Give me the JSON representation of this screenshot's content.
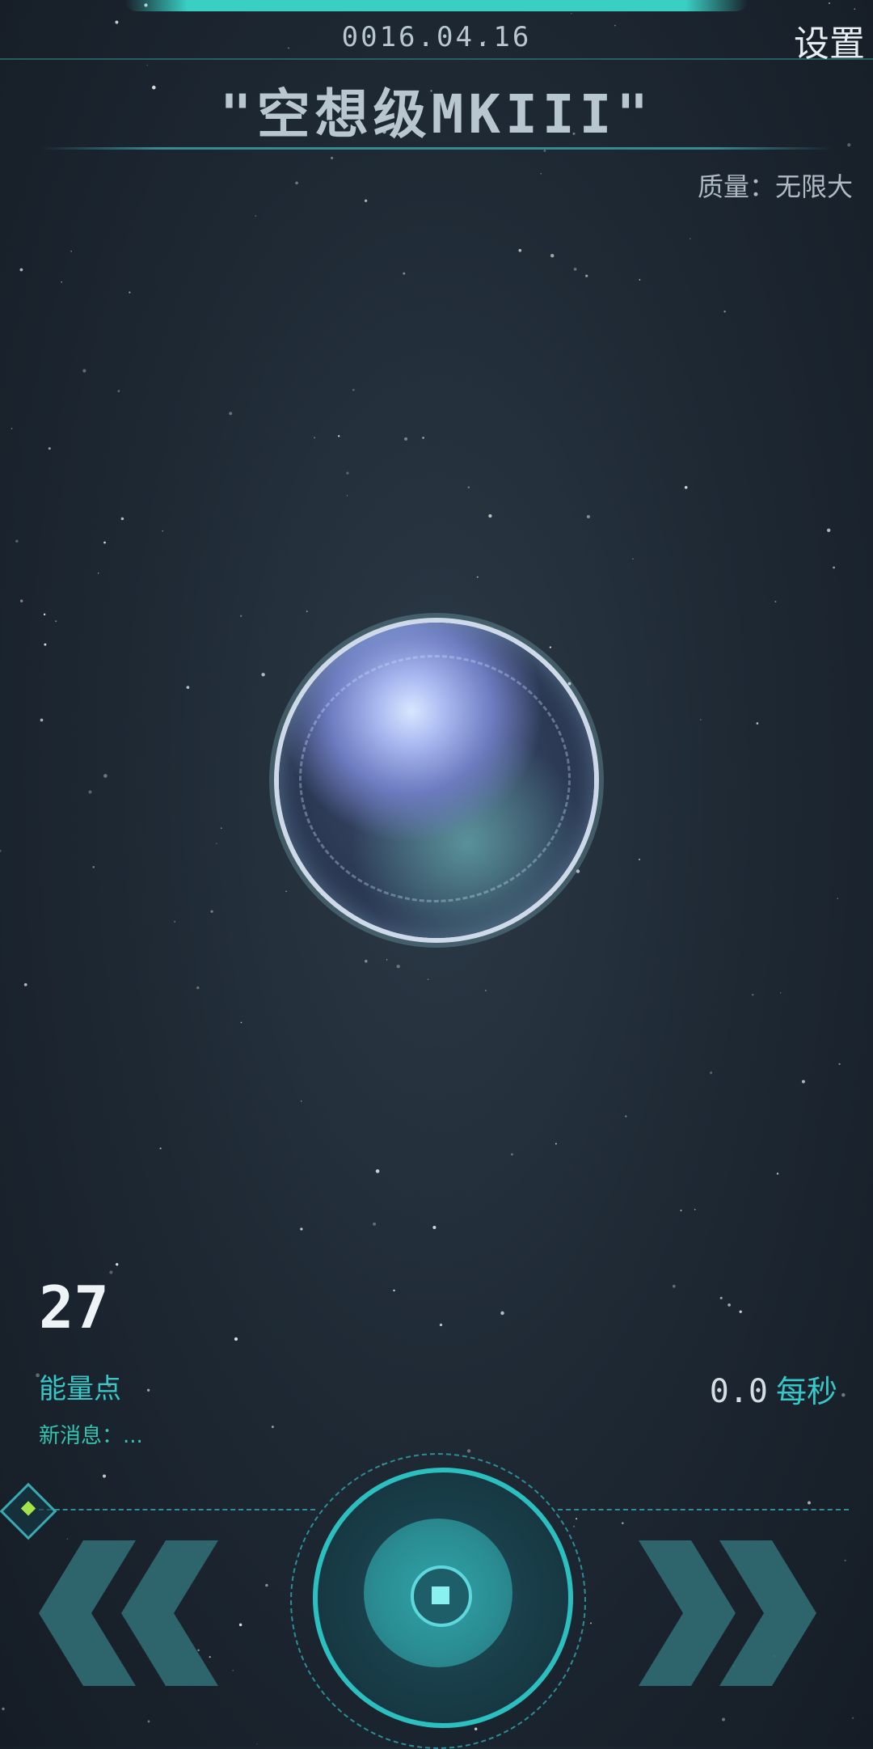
{
  "header": {
    "date": "0016.04.16",
    "settings_label": "设置",
    "title": "\"空想级MKIII\"",
    "mass_label": "质量：无限大"
  },
  "stats": {
    "energy_value": "27",
    "energy_label": "能量点",
    "rate_value": "0.0",
    "rate_unit": "每秒",
    "news_label": "新消息：..."
  },
  "controls": {
    "left_icon": "chevron-double-left-icon",
    "right_icon": "chevron-double-right-icon",
    "center_icon": "core-button-icon",
    "indicator_icon": "diamond-indicator-icon"
  },
  "colors": {
    "accent": "#36c7c6",
    "background": "#1f2a35",
    "arrow": "#2f6870"
  }
}
